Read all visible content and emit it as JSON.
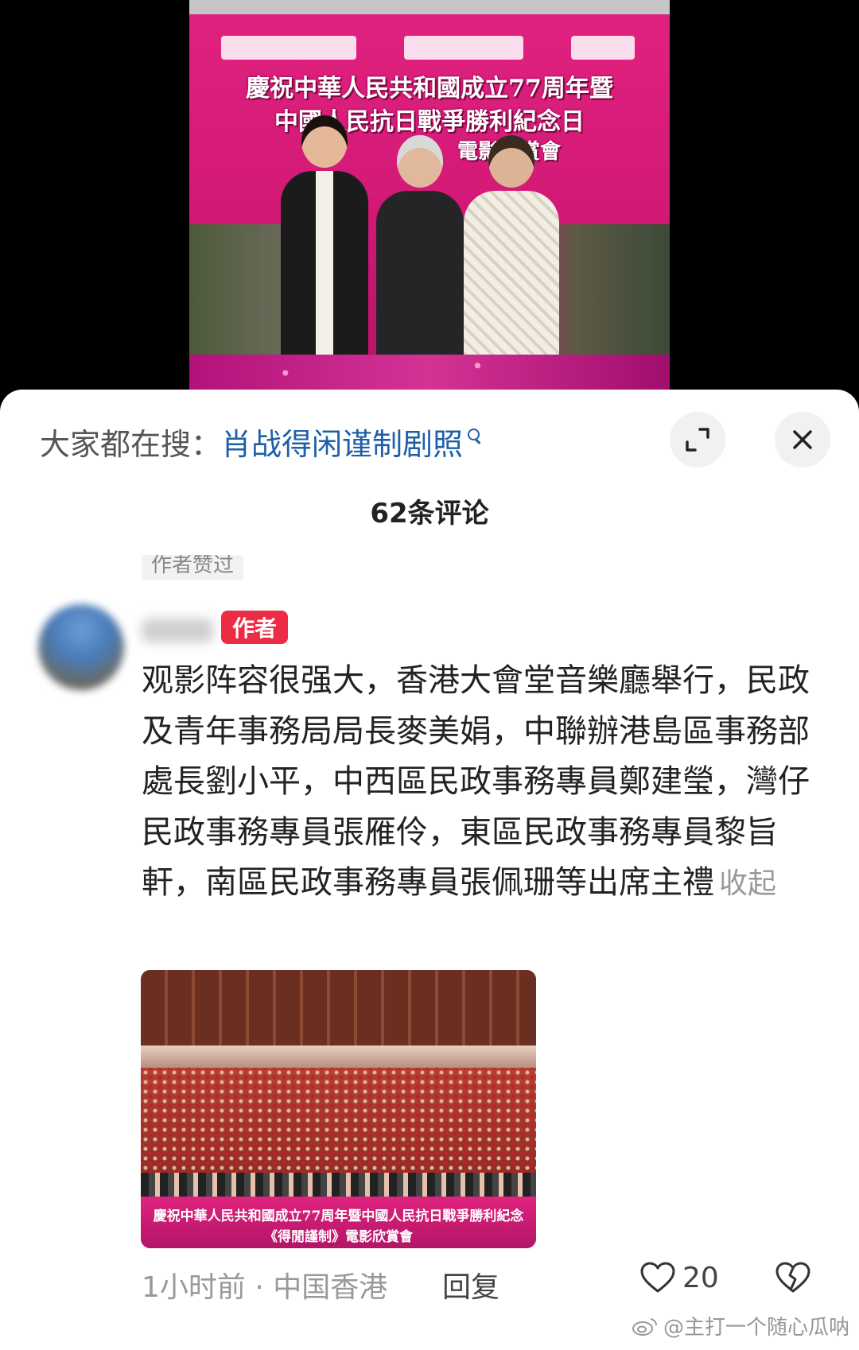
{
  "photo": {
    "banner_line_1": "慶祝中華人民共和國成立77周年暨",
    "banner_line_2": "中國人民抗日戰爭勝利紀念日",
    "banner_line_3": "電影欣賞會"
  },
  "search": {
    "prefix": "大家都在搜：",
    "term": "肖战得闲谨制剧照"
  },
  "comments_header": {
    "count_label": "62条评论"
  },
  "comment": {
    "liked_tag": "作者赞过",
    "author_badge": "作者",
    "text": "观影阵容很强大，香港大會堂音樂廳舉行，民政及青年事務局局長麥美娟，中聯辦港島區事務部處長劉小平，中西區民政事務專員鄭建瑩，灣仔民政事務專員張雁伶，東區民政事務專員黎旨軒，南區民政事務專員張佩珊等出席主禮",
    "collapse_label": "收起",
    "image_banner_line_1": "慶祝中華人民共和國成立77周年暨中國人民抗日戰爭勝利紀念",
    "image_banner_line_2": "《得閒謹制》電影欣賞會",
    "time_location": "1小时前 · 中国香港",
    "reply_label": "回复",
    "like_count": "20"
  },
  "watermark": {
    "text": "@主打一个随心瓜呐"
  },
  "icons": {
    "expand": "expand-icon",
    "close": "close-icon",
    "search": "search-icon",
    "like": "heart-icon",
    "dislike": "broken-heart-icon",
    "weibo": "weibo-icon"
  },
  "colors": {
    "search_term": "#1f5fa8",
    "author_badge": "#ec2b45",
    "poster_pink": "#e0237f"
  }
}
